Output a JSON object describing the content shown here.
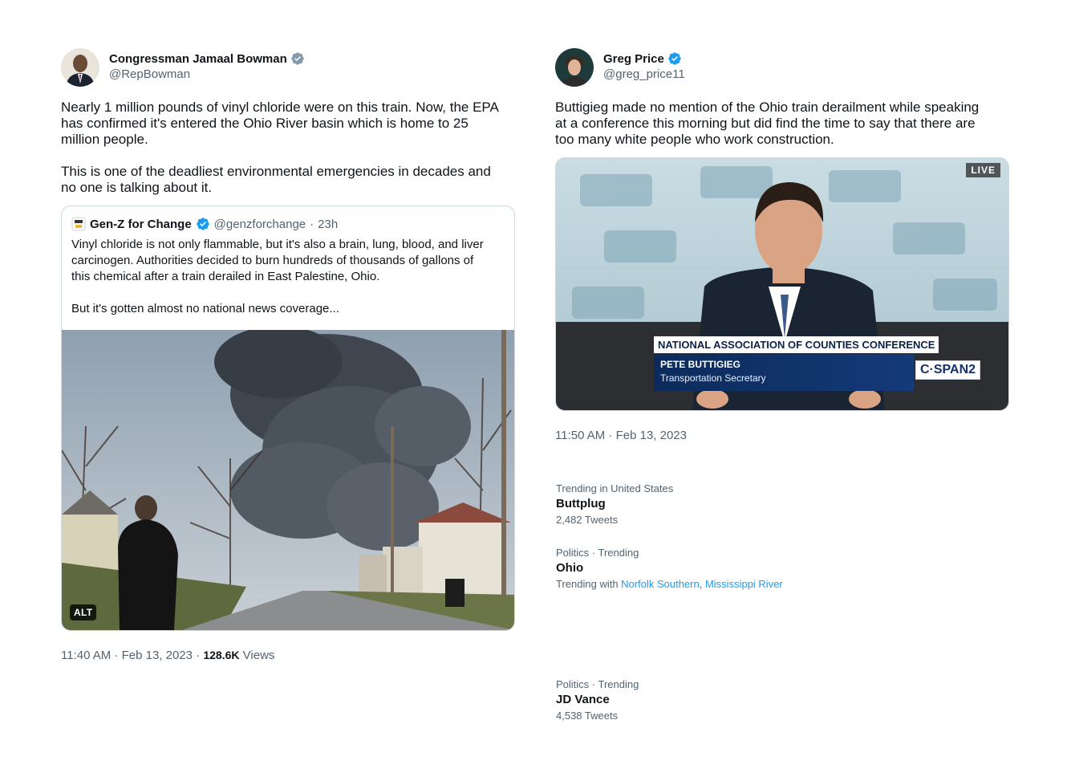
{
  "left_tweet": {
    "author_name": "Congressman Jamaal Bowman",
    "author_handle": "@RepBowman",
    "text": "Nearly 1 million pounds of vinyl chloride were on this train. Now, the EPA\nhas confirmed it's entered the Ohio River basin which is home to 25\nmillion people.\n\nThis is one of the deadliest environmental emergencies in decades and\nno one is talking about it.",
    "quote": {
      "author_name": "Gen-Z for Change",
      "author_handle": "@genzforchange",
      "separator": "·",
      "time": "23h",
      "text": "Vinyl chloride is not only flammable, but it's also a brain, lung, blood, and liver\ncarcinogen. Authorities decided to burn hundreds of thousands of gallons of\nthis chemical after a train derailed in East Palestine, Ohio.\n\nBut it's gotten almost no national news coverage...",
      "alt_badge": "ALT"
    },
    "timestamp": "11:40 AM · Feb 13, 2023 · ",
    "views_count": "128.6K",
    "views_label": "Views"
  },
  "right_tweet": {
    "author_name": "Greg Price",
    "author_handle": "@greg_price11",
    "text": "Buttigieg made no mention of the Ohio train derailment while speaking\nat a conference this morning but did find the time to say that there are\ntoo many white people who work construction.",
    "video": {
      "live_badge": "LIVE",
      "banner_title": "NATIONAL ASSOCIATION OF COUNTIES CONFERENCE",
      "speaker_name": "PETE BUTTIGIEG",
      "speaker_title": "Transportation Secretary",
      "network": "C·SPAN2"
    },
    "timestamp": "11:50 AM · Feb 13, 2023"
  },
  "trends": [
    {
      "context": "Trending in United States",
      "title": "Buttplug",
      "sub": "2,482 Tweets"
    },
    {
      "context": "Politics · Trending",
      "title": "Ohio",
      "sub_prefix": "Trending with ",
      "links": [
        "Norfolk Southern",
        "Mississippi River"
      ],
      "link_sep": ", "
    },
    {
      "context": "Politics · Trending",
      "title": "JD Vance",
      "sub": "4,538 Tweets"
    }
  ],
  "colors": {
    "verified": "#1d9bf0",
    "link": "#1d9bf0",
    "muted": "#536471",
    "text": "#0f1419"
  },
  "icons": [
    "verified-badge-icon",
    "genz-logo-icon"
  ]
}
